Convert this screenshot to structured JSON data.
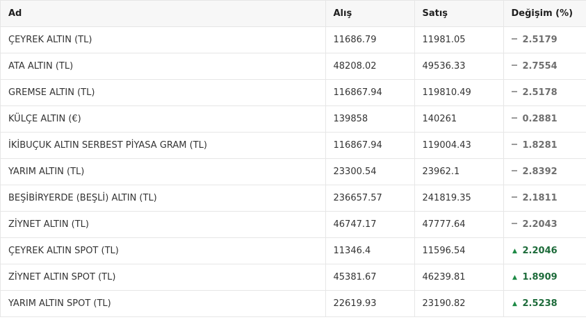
{
  "columns": {
    "name": "Ad",
    "buy": "Alış",
    "sell": "Satış",
    "change": "Değişim (%)"
  },
  "rows": [
    {
      "name": "ÇEYREK ALTIN (TL)",
      "buy": "11686.79",
      "sell": "11981.05",
      "change": "2.5179",
      "trend": "flat"
    },
    {
      "name": "ATA ALTIN (TL)",
      "buy": "48208.02",
      "sell": "49536.33",
      "change": "2.7554",
      "trend": "flat"
    },
    {
      "name": "GREMSE ALTIN (TL)",
      "buy": "116867.94",
      "sell": "119810.49",
      "change": "2.5178",
      "trend": "flat"
    },
    {
      "name": "KÜLÇE ALTIN (€)",
      "buy": "139858",
      "sell": "140261",
      "change": "0.2881",
      "trend": "flat"
    },
    {
      "name": "İKİBUÇUK ALTIN SERBEST PİYASA GRAM (TL)",
      "buy": "116867.94",
      "sell": "119004.43",
      "change": "1.8281",
      "trend": "flat"
    },
    {
      "name": "YARIM ALTIN (TL)",
      "buy": "23300.54",
      "sell": "23962.1",
      "change": "2.8392",
      "trend": "flat"
    },
    {
      "name": "BEŞİBİRYERDE (BEŞLİ) ALTIN (TL)",
      "buy": "236657.57",
      "sell": "241819.35",
      "change": "2.1811",
      "trend": "flat"
    },
    {
      "name": "ZİYNET ALTIN (TL)",
      "buy": "46747.17",
      "sell": "47777.64",
      "change": "2.2043",
      "trend": "flat"
    },
    {
      "name": "ÇEYREK ALTIN SPOT (TL)",
      "buy": "11346.4",
      "sell": "11596.54",
      "change": "2.2046",
      "trend": "up"
    },
    {
      "name": "ZİYNET ALTIN SPOT (TL)",
      "buy": "45381.67",
      "sell": "46239.81",
      "change": "1.8909",
      "trend": "up"
    },
    {
      "name": "YARIM ALTIN SPOT (TL)",
      "buy": "22619.93",
      "sell": "23190.82",
      "change": "2.5238",
      "trend": "up"
    }
  ],
  "icons": {
    "flat": "dash-icon",
    "up": "triangle-up-icon"
  },
  "colors": {
    "up": "#1d6b3a",
    "flat": "#6f6f6f"
  }
}
